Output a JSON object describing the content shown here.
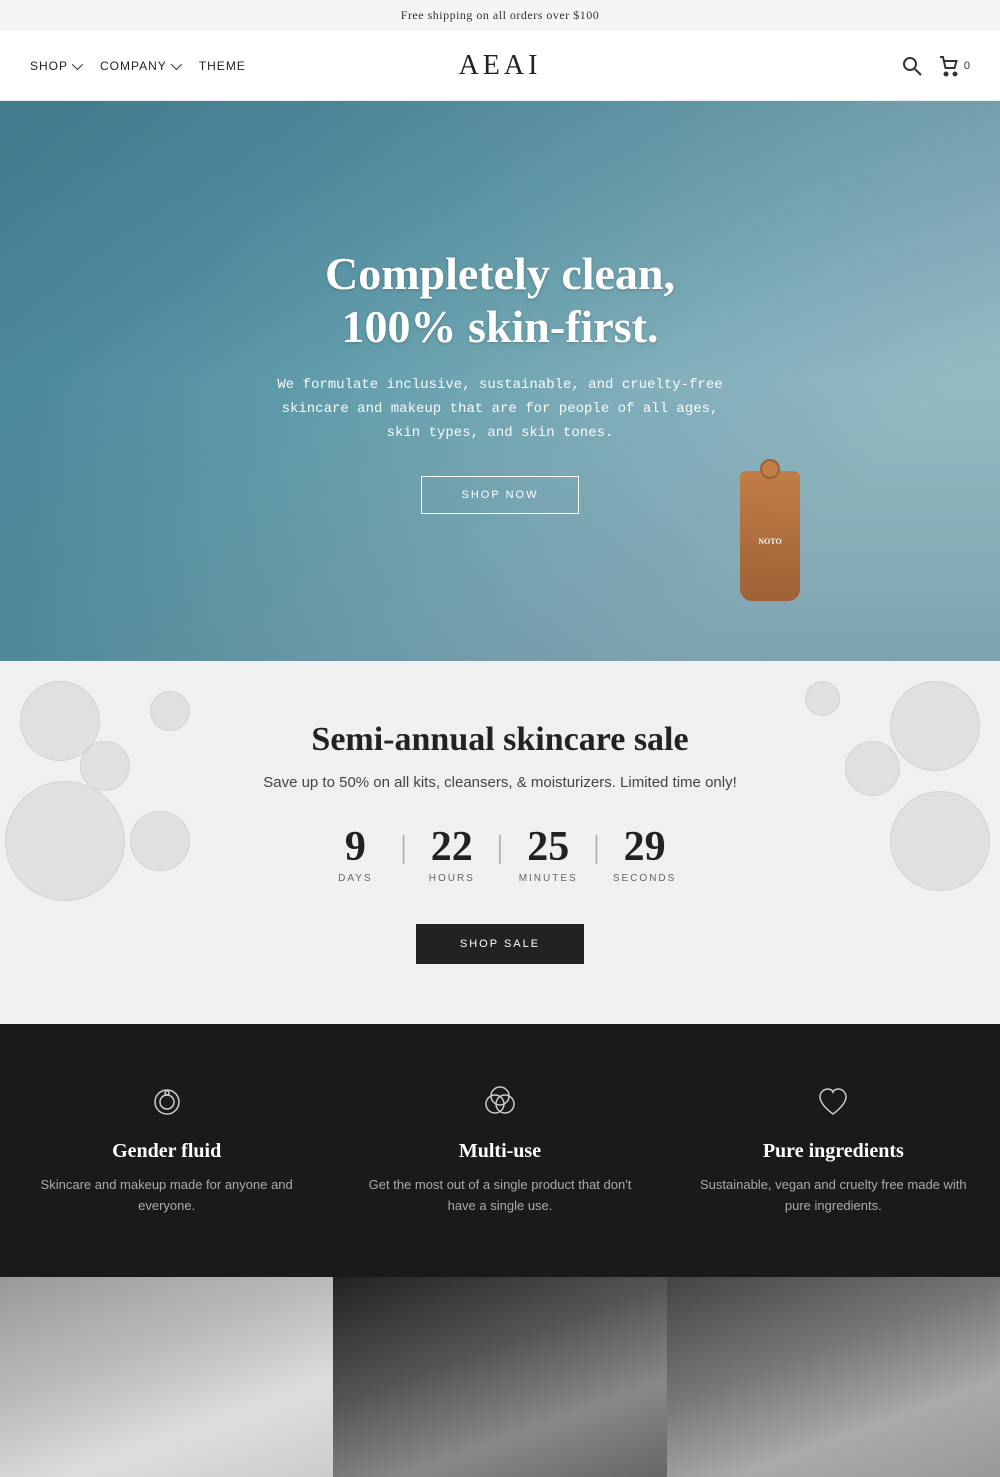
{
  "banner": {
    "text": "Free shipping on all orders over $100"
  },
  "header": {
    "nav": [
      {
        "label": "SHOP",
        "has_dropdown": true
      },
      {
        "label": "COMPANY",
        "has_dropdown": true
      },
      {
        "label": "THEME",
        "has_dropdown": false
      }
    ],
    "logo": "AEAI",
    "cart_count": "0"
  },
  "hero": {
    "title": "Completely clean, 100% skin-first.",
    "subtitle": "We formulate inclusive, sustainable, and cruelty-free\nskincare and makeup that are for people of all ages, skin\ntypes, and skin tones.",
    "cta_label": "SHOP NOW"
  },
  "sale": {
    "title": "Semi-annual skincare sale",
    "subtitle": "Save up to 50% on all kits, cleansers, & moisturizers. Limited time only!",
    "countdown": {
      "days": "9",
      "hours": "22",
      "minutes": "25",
      "seconds": "29"
    },
    "days_label": "DAYS",
    "hours_label": "HOURS",
    "minutes_label": "MINUTES",
    "seconds_label": "SECONDS",
    "cta_label": "SHOP SALE"
  },
  "features": [
    {
      "icon": "ring-icon",
      "title": "Gender fluid",
      "desc": "Skincare and makeup made for anyone and everyone."
    },
    {
      "icon": "circles-icon",
      "title": "Multi-use",
      "desc": "Get the most out of a single product that don't have a single use."
    },
    {
      "icon": "heart-icon",
      "title": "Pure ingredients",
      "desc": "Sustainable, vegan and cruelty free made with pure ingredients."
    }
  ]
}
